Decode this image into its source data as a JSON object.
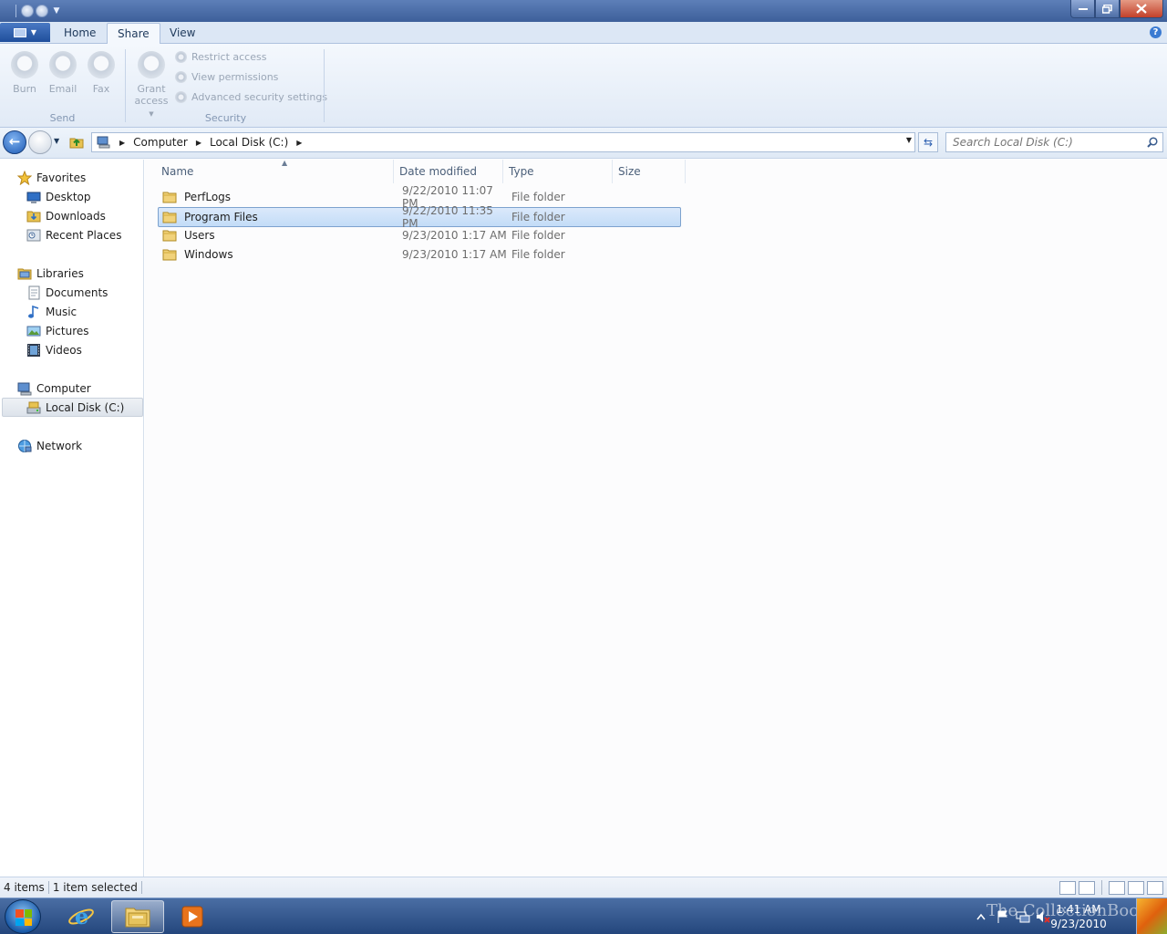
{
  "ribbon": {
    "tabs": [
      "Home",
      "Share",
      "View"
    ],
    "active_tab": "Share",
    "send_group": {
      "label": "Send",
      "buttons": [
        "Burn",
        "Email",
        "Fax"
      ]
    },
    "security_group": {
      "label": "Security",
      "grant_line1": "Grant",
      "grant_line2": "access",
      "small_buttons": [
        "Restrict access",
        "View permissions",
        "Advanced security settings"
      ]
    },
    "help": "?"
  },
  "address": {
    "crumbs": [
      "Computer",
      "Local Disk (C:)"
    ],
    "search_placeholder": "Search Local Disk (C:)"
  },
  "nav": {
    "favorites": {
      "label": "Favorites",
      "items": [
        "Desktop",
        "Downloads",
        "Recent Places"
      ]
    },
    "libraries": {
      "label": "Libraries",
      "items": [
        "Documents",
        "Music",
        "Pictures",
        "Videos"
      ]
    },
    "computer": {
      "label": "Computer",
      "items": [
        "Local Disk (C:)"
      ],
      "selected": "Local Disk (C:)"
    },
    "network": {
      "label": "Network"
    }
  },
  "columns": [
    "Name",
    "Date modified",
    "Type",
    "Size"
  ],
  "files": [
    {
      "name": "PerfLogs",
      "date": "9/22/2010 11:07 PM",
      "type": "File folder",
      "size": ""
    },
    {
      "name": "Program Files",
      "date": "9/22/2010 11:35 PM",
      "type": "File folder",
      "size": "",
      "selected": true
    },
    {
      "name": "Users",
      "date": "9/23/2010 1:17 AM",
      "type": "File folder",
      "size": ""
    },
    {
      "name": "Windows",
      "date": "9/23/2010 1:17 AM",
      "type": "File folder",
      "size": ""
    }
  ],
  "status": {
    "items": "4 items",
    "selected": "1 item selected"
  },
  "taskbar": {
    "time": "1:41 AM",
    "date": "9/23/2010",
    "watermark": "The CollectionBook"
  },
  "colors": {
    "selection_bg": "#c3dcf7",
    "selection_border": "#7da2ce",
    "ribbon_bg": "#e1eaf6",
    "title_bar": "#3d5f9a",
    "taskbar": "#24467c"
  }
}
